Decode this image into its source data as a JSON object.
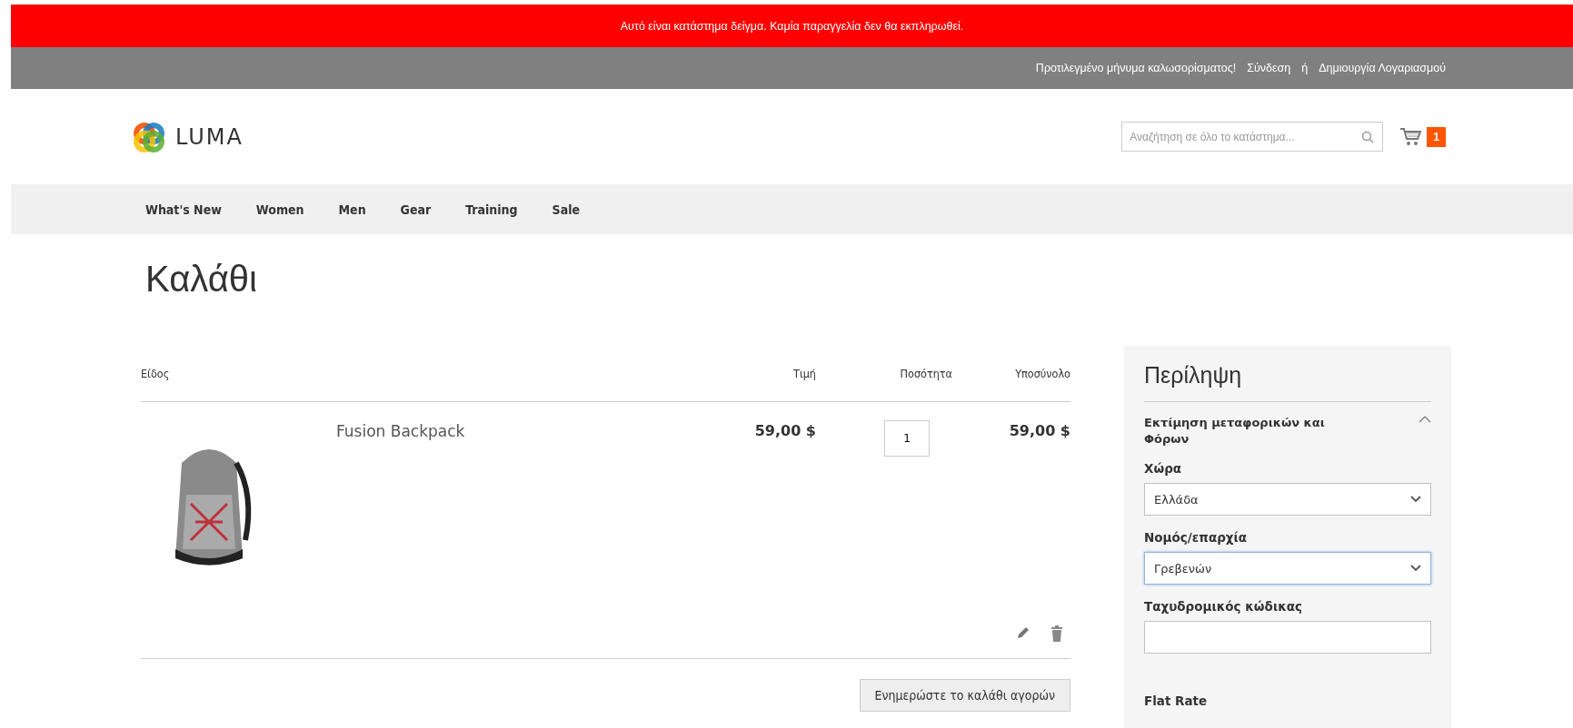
{
  "notice": {
    "text": "Αυτό είναι κατάστημα δείγμα. Καμία παραγγελία δεν θα εκπληρωθεί."
  },
  "top_links": {
    "welcome": "Προτιλεγμένο μήνυμα καλωσορίσματος!",
    "sign_in": "Σύνδεση",
    "separator": "ή",
    "create_account": "Δημιουργία Λογαριασμού"
  },
  "header": {
    "logo_text": "LUMA",
    "search": {
      "placeholder": "Αναζήτηση σε όλο το κατάστημα..."
    },
    "cart_count": "1"
  },
  "nav": {
    "items": [
      "What's New",
      "Women",
      "Men",
      "Gear",
      "Training",
      "Sale"
    ]
  },
  "page_title": "Καλάθι",
  "cart": {
    "columns": [
      "Είδος",
      "Τιμή",
      "Ποσότητα",
      "Υποσύνολο"
    ],
    "items": [
      {
        "name": "Fusion Backpack",
        "price": "59,00 $",
        "qty": "1",
        "subtotal": "59,00 $"
      }
    ],
    "update_button": "Ενημερώστε το καλάθι αγορών"
  },
  "summary": {
    "title": "Περίληψη",
    "section": {
      "title": "Εκτίμηση μεταφορικών και Φόρων",
      "expanded": true
    },
    "fields": [
      {
        "kind": "select",
        "label": "Χώρα",
        "value": "Ελλάδα",
        "focused": false
      },
      {
        "kind": "select",
        "label": "Νομός/επαρχία",
        "value": "Γρεβενών",
        "focused": true
      },
      {
        "kind": "text",
        "label": "Ταχυδρομικός κώδικας",
        "focused": false
      }
    ],
    "shipping_method": "Flat Rate"
  }
}
